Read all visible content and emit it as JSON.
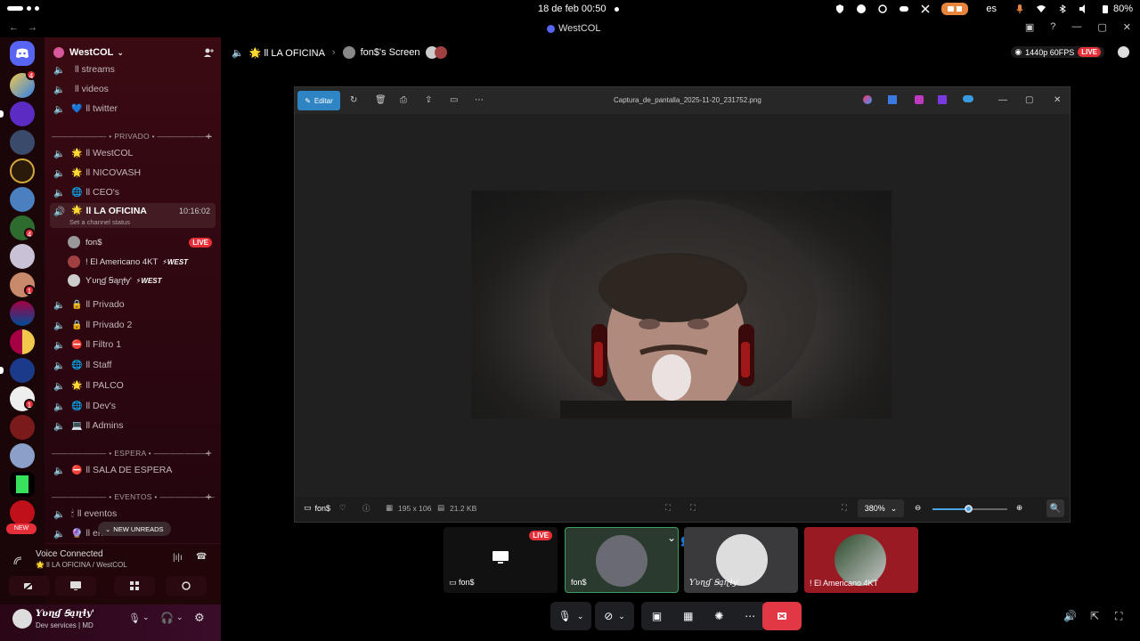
{
  "os_bar": {
    "date_time": "18 de feb  00:50",
    "lang": "es",
    "battery": "80%"
  },
  "window": {
    "title": "WestCOL"
  },
  "server": {
    "name": "WestCOL",
    "colors": {
      "accent": "#d9589b",
      "live": "#e5303a",
      "brand": "#5865f2"
    }
  },
  "rail": {
    "badges": [
      "4",
      "1",
      "1",
      "1"
    ],
    "new_label": "NEW"
  },
  "channels": {
    "top": [
      {
        "name": "ll streams",
        "emoji": ""
      },
      {
        "name": "ll videos",
        "emoji": ""
      },
      {
        "name": "ll twitter",
        "emoji": "💙"
      }
    ],
    "cat_privado": "——————— • PRIVADO • ———————",
    "privado": [
      {
        "name": "ll WestCOL",
        "emoji": "🌟"
      },
      {
        "name": "ll NICOVASH",
        "emoji": "🌟"
      },
      {
        "name": "ll CEO's",
        "emoji": "🌐"
      }
    ],
    "active": {
      "name": "ll LA OFICINA",
      "emoji": "🌟",
      "timer": "10:16:02",
      "status": "Set a channel status"
    },
    "members": [
      {
        "name": "fon$",
        "live": "LIVE"
      },
      {
        "name": "! El Americano 4KT",
        "tag": "⚡WEST"
      },
      {
        "name": "Ƴʋɳɠ Ꞩąɳɬy'",
        "tag": "⚡WEST"
      }
    ],
    "more": [
      {
        "name": "ll Privado",
        "emoji": "🔒"
      },
      {
        "name": "ll Privado 2",
        "emoji": "🔒"
      },
      {
        "name": "ll Filtro 1",
        "emoji": "⛔"
      },
      {
        "name": "ll Staff",
        "emoji": "🌐"
      },
      {
        "name": "ll PALCO",
        "emoji": "🌟"
      },
      {
        "name": "ll Dev's",
        "emoji": "🌐"
      },
      {
        "name": "ll Admins",
        "emoji": "💻"
      }
    ],
    "cat_espera": "——————— • ESPERA • ———————",
    "espera": [
      {
        "name": "ll SALA DE ESPERA",
        "emoji": "⛔"
      }
    ],
    "cat_eventos": "——————— • EVENTOS • ———————",
    "eventos": [
      {
        "name": "ll eventos",
        "emoji": "🕯"
      },
      {
        "name": "ll en",
        "emoji": "🔮"
      }
    ],
    "new_unreads": "NEW UNREADS"
  },
  "voice": {
    "status": "Voice Connected",
    "location": "🌟 ll LA OFICINA / WestCOL"
  },
  "user": {
    "name": "Ƴʋɳɠ Ꞩąɳɬy'",
    "status": "Dev services | MD"
  },
  "main_header": {
    "channel": "🌟 ll LA OFICINA",
    "screen": "fon$'s Screen",
    "quality": "1440p 60FPS",
    "live": "LIVE"
  },
  "photos": {
    "edit_label": "Editar",
    "filename": "Captura_de_pantalla_2025-11-20_231752.png",
    "owner": "fon$",
    "dimensions": "195 x 106",
    "size": "21.2 KB",
    "zoom": "380%",
    "zoom_level": 0.48
  },
  "tiles": [
    {
      "name": "fon$",
      "live": "LIVE"
    },
    {
      "name": "fon$"
    },
    {
      "name": "Ƴʋɳɠ Ꞩąɳɬy'"
    },
    {
      "name": "! El Americano 4KT"
    }
  ]
}
